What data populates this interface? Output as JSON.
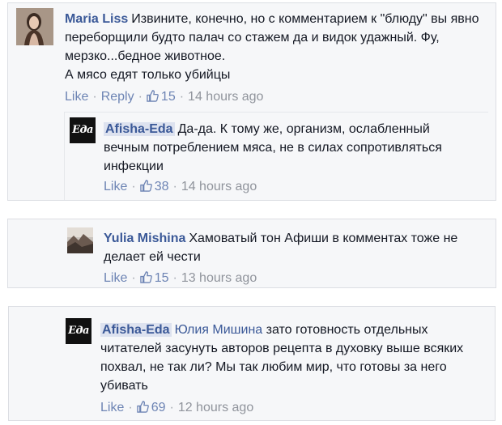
{
  "comments": [
    {
      "author": "Maria Liss",
      "text": "Извините, конечно, но с комментарием к \"блюду\" вы явно переборщили будто палач со стажем да и видок удажный. Фу, мерзко...бедное животное.",
      "text2": "А мясо едят только убийцы",
      "like": "Like",
      "reply": "Reply",
      "likes": "15",
      "time": "14 hours ago",
      "avatar_icon": "user-photo-icon"
    },
    {
      "author": "Afisha-Eda",
      "text": "Да-да. К тому же, организм, ослабленный вечным потреблением мяса, не в силах сопротивляться инфекции",
      "like": "Like",
      "likes": "38",
      "time": "14 hours ago",
      "avatar_icon": "eda-logo-icon",
      "avatar_label": "Eда"
    },
    {
      "author": "Yulia Mishina",
      "text": "Хамоватый тон Афиши в комментах тоже не делает ей чести",
      "like": "Like",
      "likes": "15",
      "time": "13 hours ago",
      "avatar_icon": "landscape-photo-icon"
    },
    {
      "author": "Afisha-Eda",
      "mention": "Юлия Мишина",
      "text": "зато готовность отдельных читателей засунуть авторов рецепта в духовку выше всяких похвал, не так ли? Мы так любим мир, что готовы за него убивать",
      "like": "Like",
      "likes": "69",
      "time": "12 hours ago",
      "avatar_icon": "eda-logo-icon",
      "avatar_label": "Eда"
    }
  ],
  "colors": {
    "link": "#3b5998",
    "meta": "#90949c",
    "card_bg": "#f6f7f9",
    "border": "#dcdee3"
  }
}
